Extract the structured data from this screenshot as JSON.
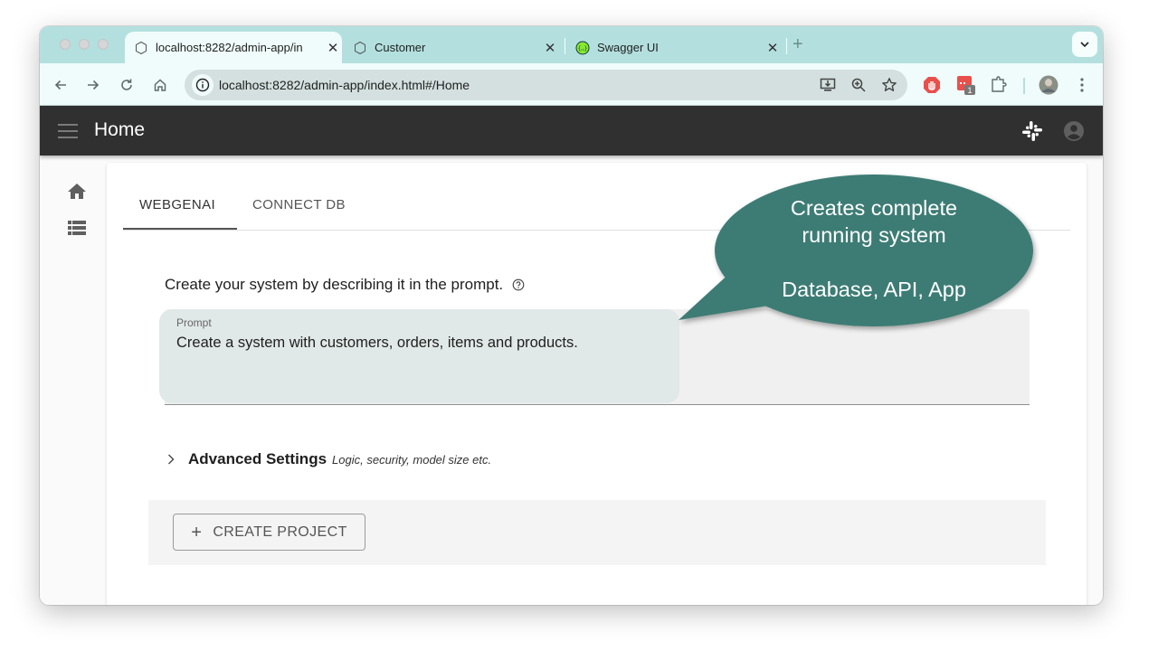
{
  "browser": {
    "tabs": [
      {
        "title": "localhost:8282/admin-app/index.html#/Home",
        "display_title": "localhost:8282/admin-app/in",
        "active": true,
        "icon": "hexagon-icon"
      },
      {
        "title": "Customer",
        "active": false,
        "icon": "hexagon-icon"
      },
      {
        "title": "Swagger UI",
        "active": false,
        "icon": "swagger-icon"
      }
    ],
    "url": "localhost:8282/admin-app/index.html#/Home",
    "extension_badge": "1"
  },
  "appbar": {
    "title": "Home"
  },
  "main": {
    "tabs": [
      {
        "label": "WEBGENAI",
        "active": true
      },
      {
        "label": "CONNECT DB",
        "active": false
      }
    ],
    "intro": "Create your system by describing it in the prompt.",
    "prompt": {
      "label": "Prompt",
      "value": "Create a system with customers, orders, items and products."
    },
    "advanced": {
      "title": "Advanced Settings",
      "subtitle": "Logic, security, model size etc."
    },
    "create_button": "CREATE PROJECT"
  },
  "callout": {
    "line1": "Creates complete",
    "line2": "running system",
    "line3": "Database, API, App",
    "color": "#3e7c74"
  }
}
